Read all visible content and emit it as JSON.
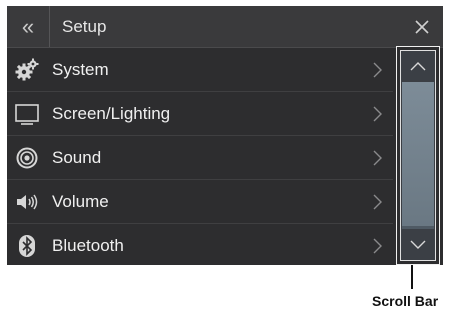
{
  "header": {
    "back_glyph": "«",
    "title": "Setup",
    "close_icon": "close-icon"
  },
  "menu": [
    {
      "label": "System",
      "icon": "gear-icon"
    },
    {
      "label": "Screen/Lighting",
      "icon": "monitor-icon"
    },
    {
      "label": "Sound",
      "icon": "speaker-icon"
    },
    {
      "label": "Volume",
      "icon": "volume-icon"
    },
    {
      "label": "Bluetooth",
      "icon": "bluetooth-icon"
    }
  ],
  "scrollbar": {
    "up_icon": "chevron-up-icon",
    "down_icon": "chevron-down-icon",
    "thumb_fraction": 0.98,
    "thumb_start": 0.0
  },
  "callout": {
    "label": "Scroll Bar"
  },
  "colors": {
    "background": "#2d2d2f",
    "header": "#3a3a3c",
    "text": "#f0f0f0",
    "scroll_thumb": "#7d8c98"
  }
}
